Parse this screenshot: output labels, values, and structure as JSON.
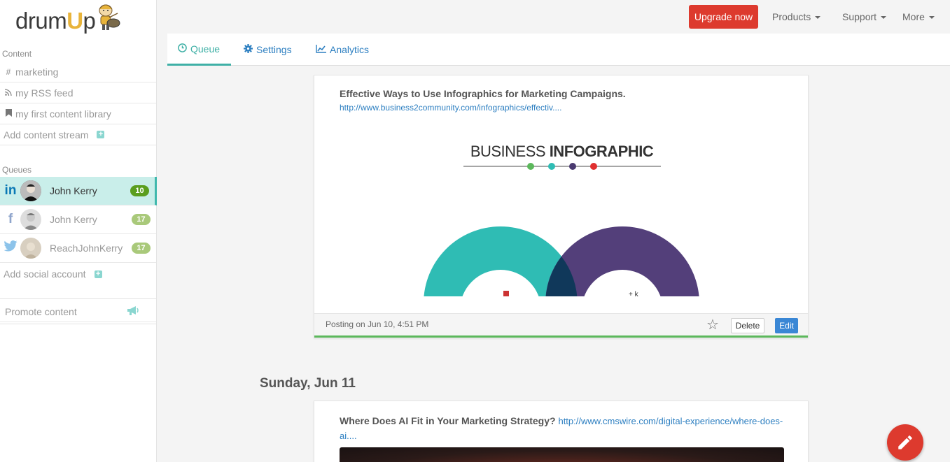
{
  "brand": {
    "logo_text_pre": "drum",
    "logo_text_u": "U",
    "logo_text_post": "p"
  },
  "sidebar": {
    "content_label": "Content",
    "content_items": [
      {
        "icon": "hash-icon",
        "label": "marketing"
      },
      {
        "icon": "rss-icon",
        "label": "my RSS feed"
      },
      {
        "icon": "bookmark-icon",
        "label": "my first content library"
      }
    ],
    "add_stream_label": "Add content stream",
    "queues_label": "Queues",
    "queues": [
      {
        "network": "linkedin",
        "name": "John Kerry",
        "count": "10",
        "badge_color": "#5a9e1e"
      },
      {
        "network": "facebook",
        "name": "John Kerry",
        "count": "17",
        "badge_color": "#a9c97a"
      },
      {
        "network": "twitter",
        "name": "ReachJohnKerry",
        "count": "17",
        "badge_color": "#a9c97a"
      }
    ],
    "add_account_label": "Add social account",
    "promote_label": "Promote content"
  },
  "topbar": {
    "upgrade_label": "Upgrade now",
    "nav": [
      "Products",
      "Support",
      "More"
    ]
  },
  "tabs": [
    {
      "label": "Queue",
      "icon": "clock-icon"
    },
    {
      "label": "Settings",
      "icon": "gear-icon"
    },
    {
      "label": "Analytics",
      "icon": "chart-icon"
    }
  ],
  "posts": [
    {
      "title": "Effective Ways to Use Infographics for Marketing Campaigns.",
      "link": "http://www.business2community.com/infographics/effectiv....",
      "image_heading_regular": "BUSINESS ",
      "image_heading_bold": "INFOGRAPHIC",
      "posting_time": "Posting on Jun 10, 4:51 PM",
      "delete_label": "Delete",
      "edit_label": "Edit"
    },
    {
      "title": "Where Does AI Fit in Your Marketing Strategy?",
      "link_line1": "http://www.cmswire.com/digital-experience/where-does-",
      "link_line2": "ai...."
    }
  ],
  "day_heading": "Sunday, Jun 11",
  "colors": {
    "accent": "#3fb0a6",
    "upgrade": "#dd3a2e",
    "link": "#2d7fc1"
  }
}
